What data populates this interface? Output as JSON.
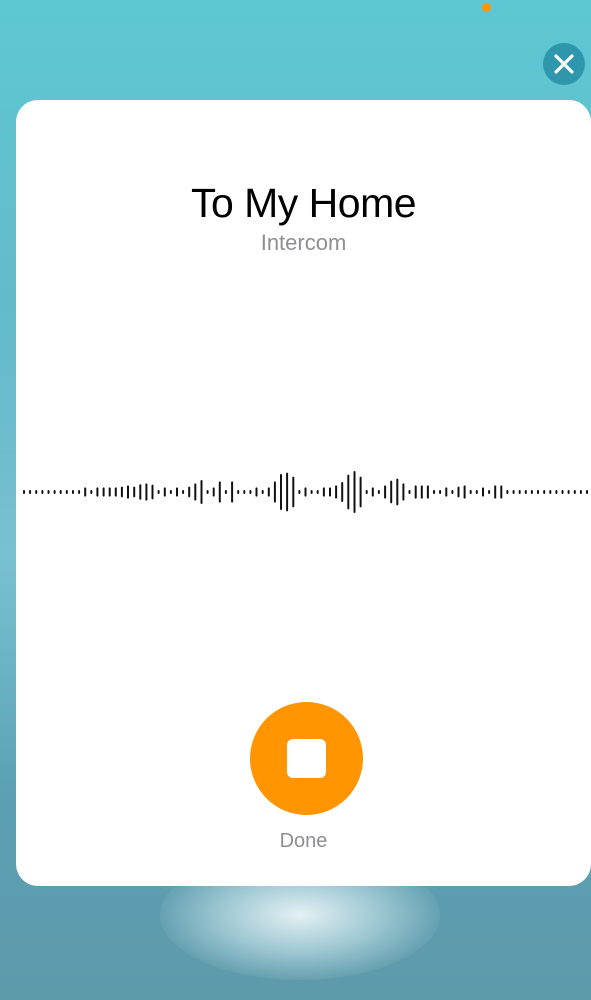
{
  "header": {
    "title": "To My Home",
    "subtitle": "Intercom"
  },
  "controls": {
    "close_icon": "close-icon",
    "stop_icon": "stop-icon",
    "done_label": "Done"
  },
  "waveform": {
    "amplitudes": [
      0.05,
      0.05,
      0.05,
      0.05,
      0.05,
      0.05,
      0.05,
      0.05,
      0.05,
      0.05,
      0.18,
      0.05,
      0.18,
      0.18,
      0.18,
      0.18,
      0.22,
      0.28,
      0.22,
      0.34,
      0.38,
      0.32,
      0.05,
      0.18,
      0.05,
      0.18,
      0.05,
      0.22,
      0.38,
      0.55,
      0.05,
      0.18,
      0.48,
      0.05,
      0.48,
      0.05,
      0.05,
      0.05,
      0.18,
      0.05,
      0.18,
      0.48,
      0.85,
      0.92,
      0.72,
      0.05,
      0.18,
      0.05,
      0.05,
      0.18,
      0.18,
      0.28,
      0.45,
      0.82,
      1.0,
      0.72,
      0.05,
      0.18,
      0.05,
      0.28,
      0.52,
      0.62,
      0.38,
      0.05,
      0.28,
      0.28,
      0.28,
      0.05,
      0.05,
      0.18,
      0.05,
      0.22,
      0.28,
      0.05,
      0.05,
      0.18,
      0.05,
      0.28,
      0.28,
      0.05,
      0.05,
      0.05,
      0.05,
      0.05,
      0.05,
      0.05,
      0.05,
      0.05,
      0.05,
      0.05,
      0.05,
      0.05,
      0.05
    ]
  },
  "colors": {
    "accent": "#ff9500",
    "close_button": "#2f97ab",
    "card": "#ffffff",
    "secondary_text": "#8e8e93"
  }
}
